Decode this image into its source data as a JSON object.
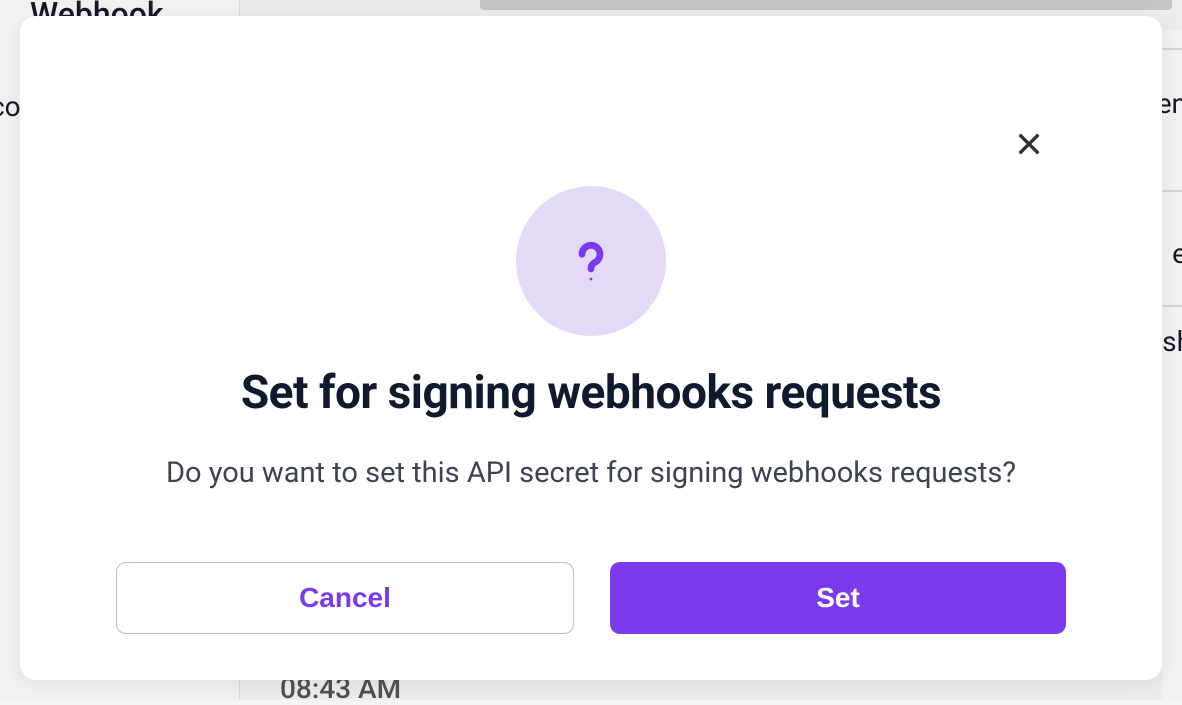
{
  "background": {
    "header": "Webhook",
    "left_text": "co",
    "right_text_1": "en",
    "right_text_2": "e",
    "right_text_3": "sh",
    "time": "08:43 AM"
  },
  "modal": {
    "title": "Set for signing webhooks requests",
    "description": "Do you want to set this API secret for signing webhooks requests?",
    "cancel_label": "Cancel",
    "confirm_label": "Set"
  }
}
